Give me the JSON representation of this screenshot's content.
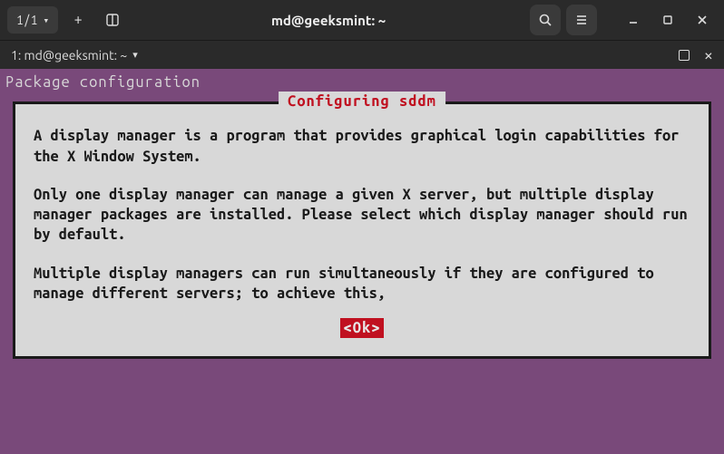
{
  "titlebar": {
    "tab_counter": "1/1",
    "title": "md@geeksmint: ~"
  },
  "tabbar": {
    "label": "1: md@geeksmint: ~"
  },
  "terminal": {
    "header": "Package configuration",
    "dialog": {
      "title": "Configuring sddm",
      "p1": "A display manager is a program that provides graphical login capabilities for the X Window System.",
      "p2": "Only one display manager can manage a given X server, but multiple display manager packages are installed. Please select which display manager should run by default.",
      "p3": "Multiple display managers can run simultaneously if they are configured to manage different servers; to achieve this,",
      "ok": "<Ok>"
    }
  }
}
